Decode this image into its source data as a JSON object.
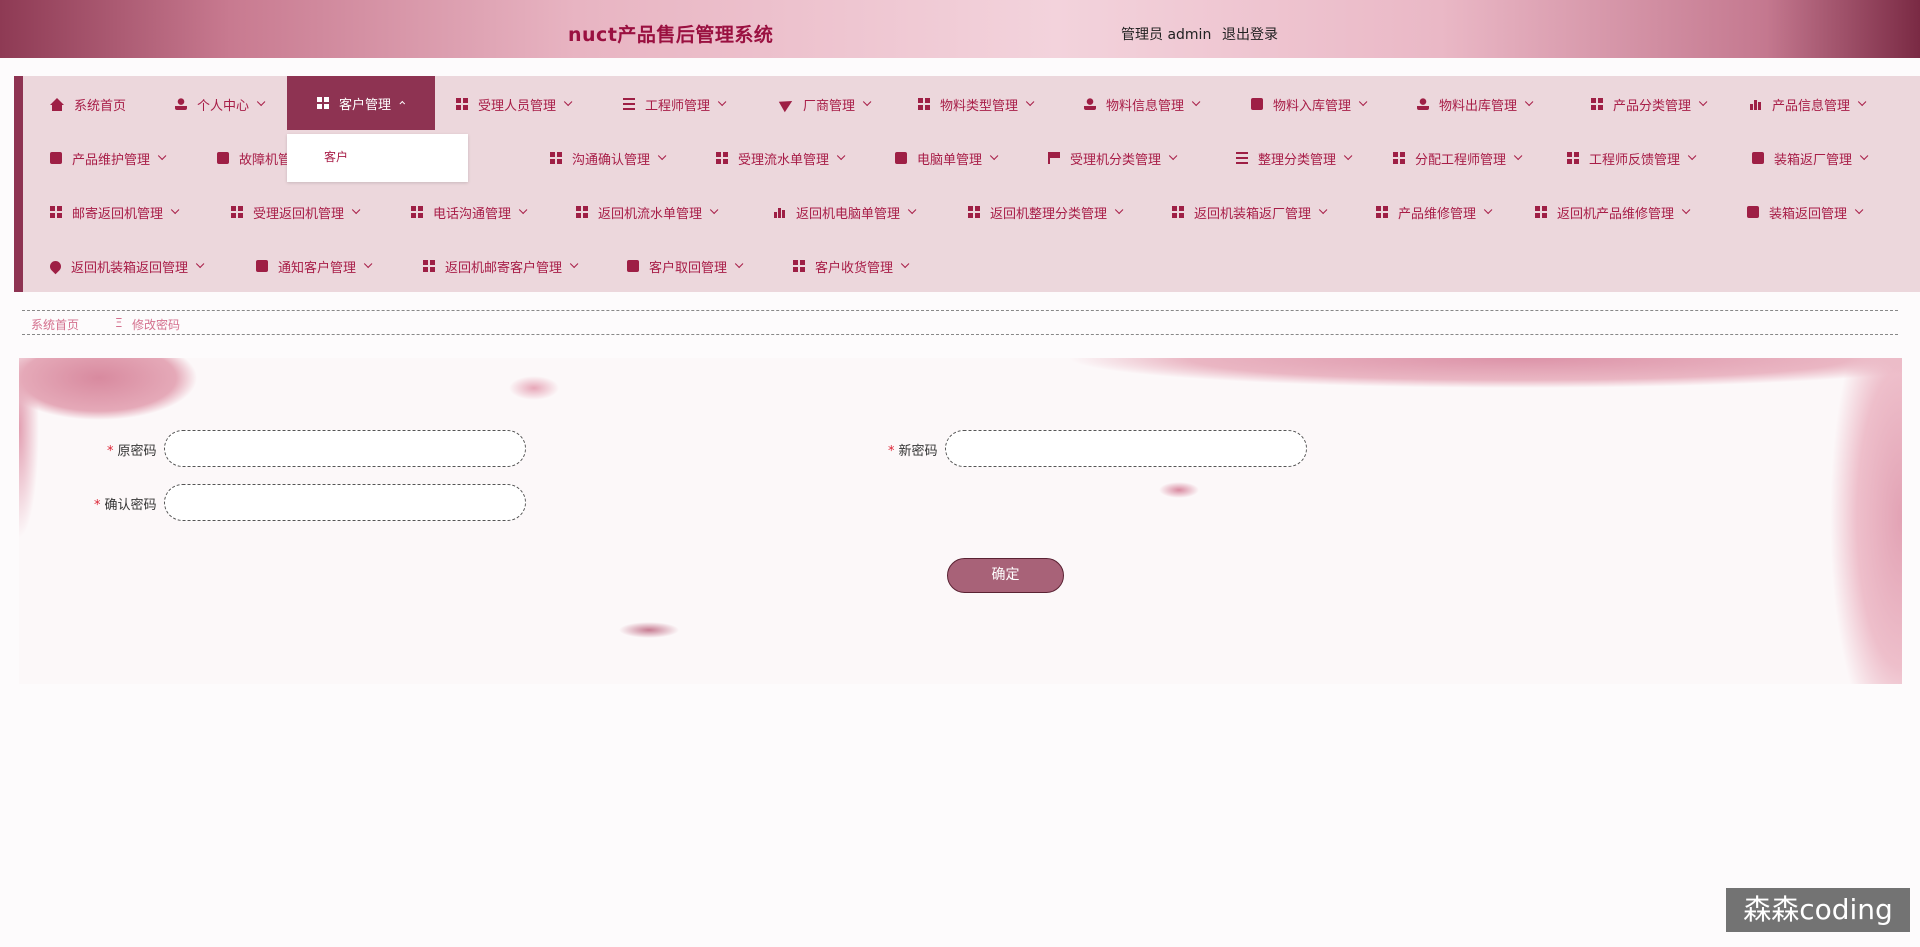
{
  "header": {
    "title": "nuct产品售后管理系统",
    "admin_label": "管理员 admin",
    "logout_label": "退出登录"
  },
  "nav": {
    "row1": [
      {
        "label": "系统首页",
        "icon": "home-icon"
      },
      {
        "label": "个人中心",
        "icon": "user-icon"
      },
      {
        "label": "客户管理",
        "icon": "grid-icon"
      },
      {
        "label": "受理人员管理",
        "icon": "grid-icon"
      },
      {
        "label": "工程师管理",
        "icon": "list-icon"
      },
      {
        "label": "厂商管理",
        "icon": "send-icon"
      },
      {
        "label": "物料类型管理",
        "icon": "grid-icon"
      },
      {
        "label": "物料信息管理",
        "icon": "user-icon"
      },
      {
        "label": "物料入库管理",
        "icon": "box-icon"
      },
      {
        "label": "物料出库管理",
        "icon": "user-icon"
      },
      {
        "label": "产品分类管理",
        "icon": "grid-icon"
      },
      {
        "label": "产品信息管理",
        "icon": "building-icon"
      }
    ],
    "row2": [
      {
        "label": "产品维护管理",
        "icon": "clipboard-icon"
      },
      {
        "label": "故障机管理",
        "icon": "clipboard-x-icon"
      },
      {
        "label": "沟通确认管理",
        "icon": "grid-icon"
      },
      {
        "label": "受理流水单管理",
        "icon": "grid-icon"
      },
      {
        "label": "电脑单管理",
        "icon": "briefcase-icon"
      },
      {
        "label": "受理机分类管理",
        "icon": "flag-icon"
      },
      {
        "label": "整理分类管理",
        "icon": "list-icon"
      },
      {
        "label": "分配工程师管理",
        "icon": "grid-icon"
      },
      {
        "label": "工程师反馈管理",
        "icon": "grid-icon"
      },
      {
        "label": "装箱返厂管理",
        "icon": "video-icon"
      }
    ],
    "row3": [
      {
        "label": "邮寄返回机管理",
        "icon": "grid-icon"
      },
      {
        "label": "受理返回机管理",
        "icon": "dots-grid-icon"
      },
      {
        "label": "电话沟通管理",
        "icon": "grid-icon"
      },
      {
        "label": "返回机流水单管理",
        "icon": "grid-icon"
      },
      {
        "label": "返回机电脑单管理",
        "icon": "bar-chart-icon"
      },
      {
        "label": "返回机整理分类管理",
        "icon": "grid-icon"
      },
      {
        "label": "返回机装箱返厂管理",
        "icon": "grid-icon"
      },
      {
        "label": "产品维修管理",
        "icon": "grid-icon"
      },
      {
        "label": "返回机产品维修管理",
        "icon": "grid-icon"
      },
      {
        "label": "装箱返回管理",
        "icon": "briefcase-icon"
      }
    ],
    "row4": [
      {
        "label": "返回机装箱返回管理",
        "icon": "map-pin-icon"
      },
      {
        "label": "通知客户管理",
        "icon": "monitor-icon"
      },
      {
        "label": "返回机邮寄客户管理",
        "icon": "grid-icon"
      },
      {
        "label": "客户取回管理",
        "icon": "clipboard-check-icon"
      },
      {
        "label": "客户收货管理",
        "icon": "grid-icon"
      }
    ],
    "dropdown_item": "客户"
  },
  "breadcrumb": {
    "home": "系统首页",
    "separator": "Ξ",
    "current": "修改密码"
  },
  "form": {
    "old_password_label": "原密码",
    "new_password_label": "新密码",
    "confirm_password_label": "确认密码",
    "required_mark": "*",
    "old_password_value": "",
    "new_password_value": "",
    "confirm_password_value": "",
    "submit_label": "确定"
  },
  "watermark": "森森coding",
  "colors": {
    "accent": "#8e3352",
    "nav_text": "#a81d47",
    "nav_bg": "#ecd7dc",
    "title": "#9a1040"
  }
}
